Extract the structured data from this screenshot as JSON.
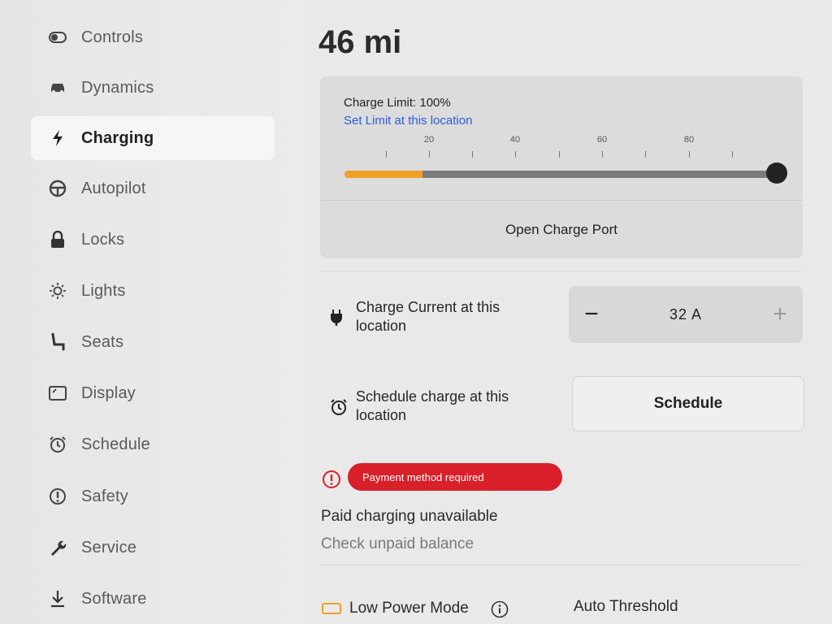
{
  "sidebar": {
    "items": [
      {
        "label": "Controls",
        "icon": "toggle-icon"
      },
      {
        "label": "Dynamics",
        "icon": "car-icon"
      },
      {
        "label": "Charging",
        "icon": "bolt-icon",
        "active": true
      },
      {
        "label": "Autopilot",
        "icon": "steering-wheel-icon"
      },
      {
        "label": "Locks",
        "icon": "lock-icon"
      },
      {
        "label": "Lights",
        "icon": "sun-icon"
      },
      {
        "label": "Seats",
        "icon": "seat-icon"
      },
      {
        "label": "Display",
        "icon": "display-icon"
      },
      {
        "label": "Schedule",
        "icon": "alarm-clock-icon"
      },
      {
        "label": "Safety",
        "icon": "exclamation-circle-icon"
      },
      {
        "label": "Service",
        "icon": "wrench-icon"
      },
      {
        "label": "Software",
        "icon": "download-icon"
      }
    ]
  },
  "main": {
    "range": "46 mi",
    "charge_card": {
      "limit_text": "Charge Limit: 100%",
      "set_limit_link": "Set Limit at this location",
      "scale_labels": [
        "20",
        "40",
        "60",
        "80"
      ],
      "current_charge_percent": 20,
      "limit_percent": 100,
      "open_port_label": "Open Charge Port",
      "fill_color": "#f0a028"
    },
    "charge_current": {
      "label": "Charge Current at this location",
      "value": "32  A",
      "minus": "−",
      "plus": "+"
    },
    "schedule": {
      "label": "Schedule charge at this location",
      "button": "Schedule"
    },
    "payment": {
      "badge": "Payment method required",
      "title": "Paid charging unavailable",
      "subtitle": "Check unpaid balance",
      "badge_color": "#d81f2a"
    },
    "low_power": {
      "label": "Low Power Mode",
      "auto_threshold": "Auto Threshold"
    }
  }
}
